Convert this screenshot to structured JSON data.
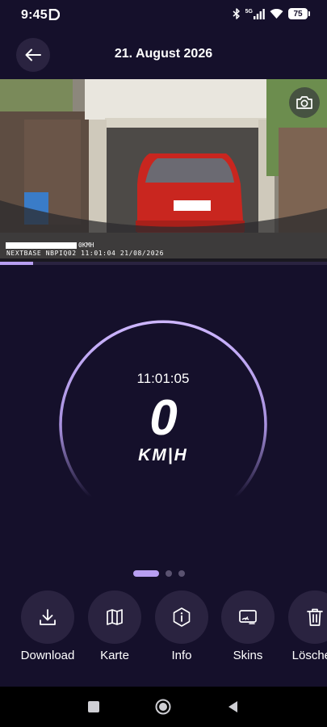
{
  "status_bar": {
    "time": "9:45",
    "network": "5G",
    "battery": "75",
    "icons": [
      "bluetooth-icon",
      "signal-icon",
      "wifi-icon",
      "battery-icon"
    ]
  },
  "header": {
    "title": "21. August 2026",
    "back_icon": "arrow-left-icon"
  },
  "video": {
    "osd_text": "NEXTBASE NBPIQ02 11:01:04 21/08/2026",
    "osd_speed": "0KMH",
    "camera_icon": "camera-icon",
    "progress": 0.1
  },
  "speedometer": {
    "time": "11:01:05",
    "speed": "0",
    "unit": "KM|H"
  },
  "pager": {
    "pages": 3,
    "active_index": 0
  },
  "actions": [
    {
      "label": "Download",
      "icon": "download-icon"
    },
    {
      "label": "Karte",
      "icon": "map-icon"
    },
    {
      "label": "Info",
      "icon": "info-icon"
    },
    {
      "label": "Skins",
      "icon": "skins-icon"
    },
    {
      "label": "Löschen",
      "icon": "trash-icon"
    }
  ],
  "nav_bar": {
    "buttons": [
      "recents-button",
      "home-button",
      "back-button"
    ]
  },
  "colors": {
    "background": "#15102b",
    "surface": "#2a2340",
    "accent": "#b89ff2"
  }
}
